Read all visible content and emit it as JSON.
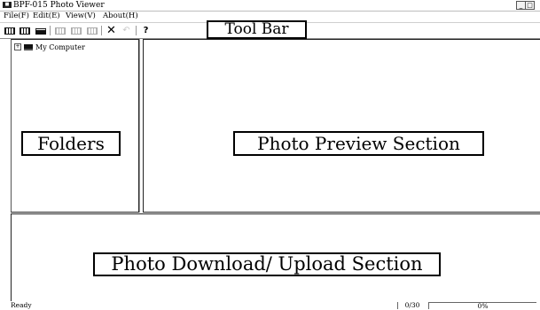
{
  "window": {
    "title": "BPF-015 Photo Viewer",
    "controls": {
      "minimize": "_",
      "maximize": "□"
    }
  },
  "menu": {
    "file": "File(F)",
    "edit": "Edit(E)",
    "view": "View(V)",
    "about": "About(H)"
  },
  "toolbar": {
    "callout": "Tool Bar",
    "buttons": [
      "download-all-icon",
      "download-selected-icon",
      "upload-icon",
      "send-all-icon",
      "send-selected-icon",
      "send-folder-icon",
      "delete-icon",
      "undo-icon",
      "help-icon"
    ]
  },
  "folders": {
    "callout": "Folders",
    "tree_root": "My Computer",
    "expander": "+"
  },
  "preview": {
    "callout": "Photo Preview Section"
  },
  "transfer": {
    "callout": "Photo Download/ Upload Section"
  },
  "status": {
    "ready": "Ready",
    "count": "0/30",
    "progress_text": "0%",
    "progress": 0
  }
}
